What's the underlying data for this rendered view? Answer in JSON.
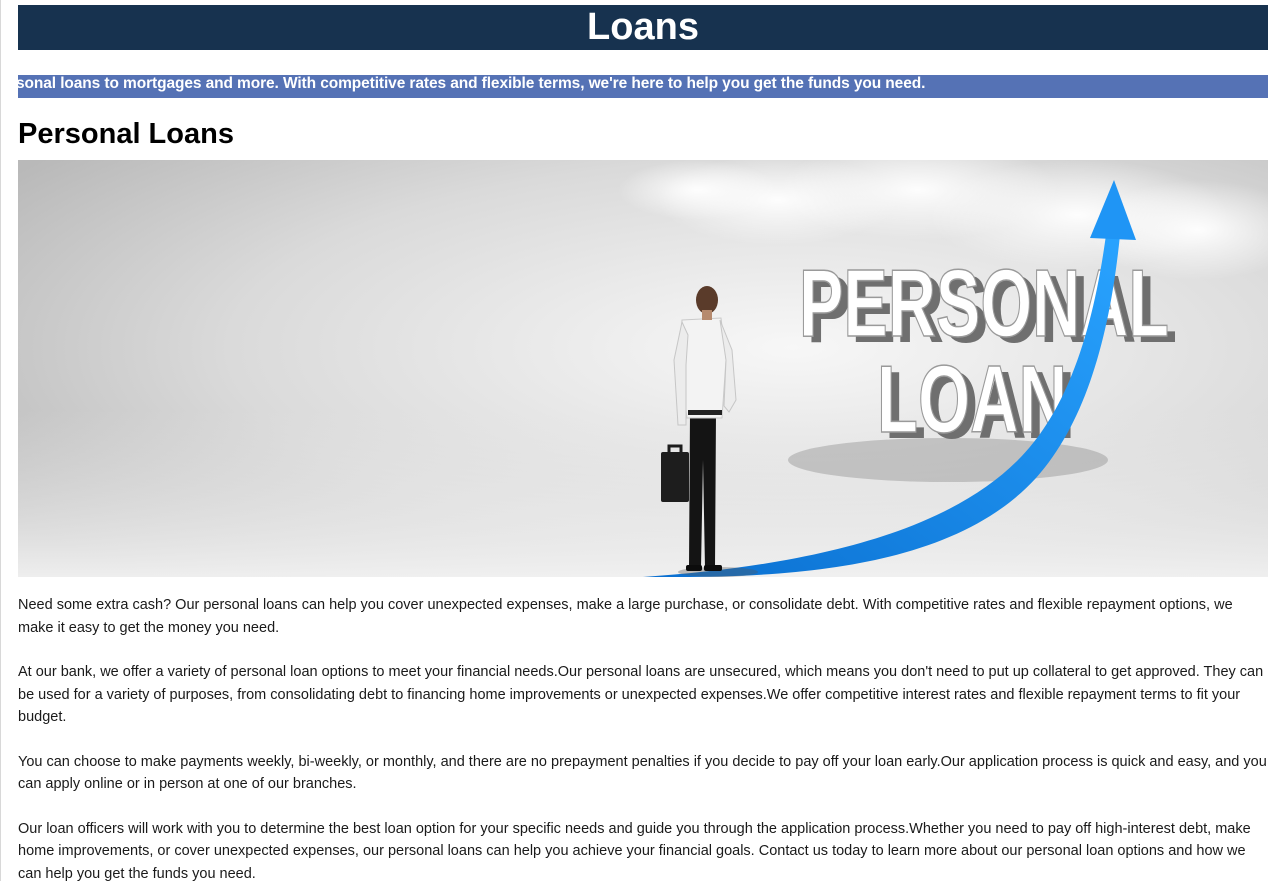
{
  "page": {
    "title": "Loans",
    "ticker": "ancial goals, from personal loans to mortgages and more. With competitive rates and flexible terms, we're here to help you get the funds you need."
  },
  "section": {
    "heading": "Personal Loans",
    "hero": {
      "text_line1": "PERSONAL",
      "text_line2": "LOAN"
    },
    "paragraphs": [
      "Need some extra cash? Our personal loans can help you cover unexpected expenses, make a large purchase, or consolidate debt. With competitive rates and flexible repayment options, we make it easy to get the money you need.",
      "At our bank, we offer a variety of personal loan options to meet your financial needs.Our personal loans are unsecured, which means you don't need to put up collateral to get approved. They can be used for a variety of purposes, from consolidating debt to financing home improvements or unexpected expenses.We offer competitive interest rates and flexible repayment terms to fit your budget.",
      "You can choose to make payments weekly, bi-weekly, or monthly, and there are no prepayment penalties if you decide to pay off your loan early.Our application process is quick and easy, and you can apply online or in person at one of our branches.",
      "Our loan officers will work with you to determine the best loan option for your specific needs and guide you through the application process.Whether you need to pay off high-interest debt, make home improvements, or cover unexpected expenses, our personal loans can help you achieve your financial goals. Contact us today to learn more about our personal loan options and how we can help you get the funds you need."
    ]
  },
  "colors": {
    "title_bar": "#17324f",
    "ticker_bar": "#5572b5",
    "arrow": "#1a8cf0"
  }
}
